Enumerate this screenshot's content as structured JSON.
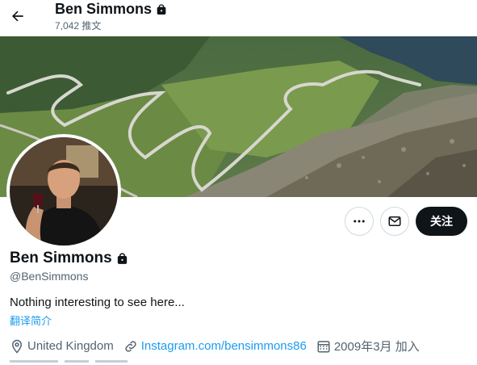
{
  "header": {
    "name": "Ben Simmons",
    "tweet_count": "7,042 推文"
  },
  "icons": {
    "back": "arrow-left-icon",
    "protected": "lock-icon",
    "more": "more-horizontal-icon",
    "message": "envelope-icon",
    "location": "location-pin-icon",
    "link": "link-icon",
    "joined": "calendar-icon"
  },
  "actions": {
    "follow_label": "关注"
  },
  "profile": {
    "name": "Ben Simmons",
    "handle": "@BenSimmons",
    "bio": "Nothing interesting to see here...",
    "translate_label": "翻译简介",
    "location": "United Kingdom",
    "website": "Instagram.com/bensimmons86",
    "joined": "2009年3月 加入"
  },
  "colors": {
    "accent": "#1d9bf0",
    "text_primary": "#0f1419",
    "text_secondary": "#536471",
    "border": "#cfd9de"
  }
}
